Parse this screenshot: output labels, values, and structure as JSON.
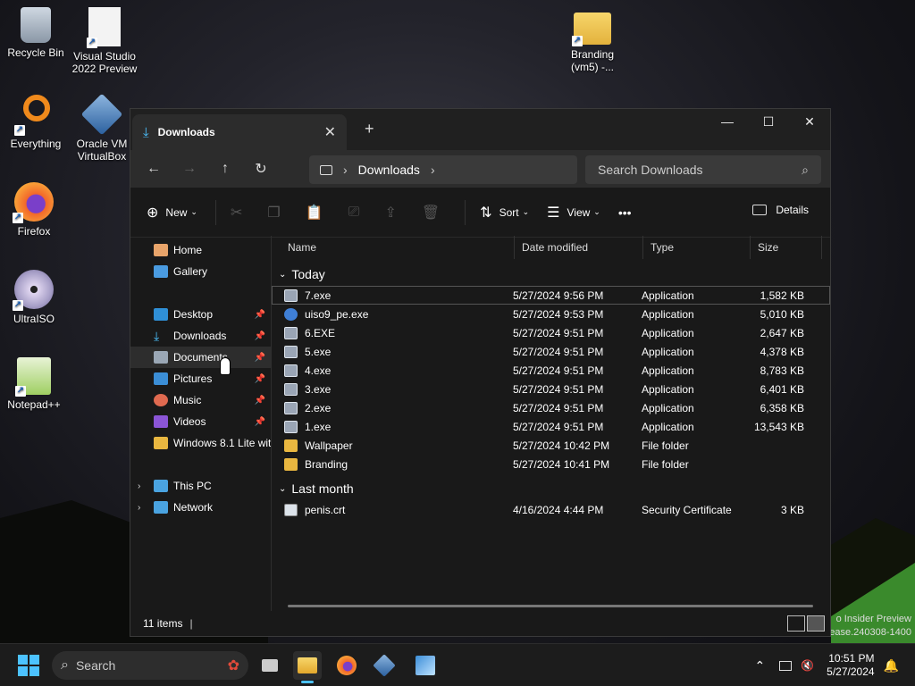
{
  "desktop": {
    "icons": [
      {
        "id": "recycle",
        "label": "Recycle Bin",
        "icon": "recycle-bin-icon"
      },
      {
        "id": "vs",
        "label": "Visual Studio 2022 Preview",
        "icon": "document-icon"
      },
      {
        "id": "branding",
        "label": "Branding (vm5) -...",
        "icon": "folder-icon"
      },
      {
        "id": "everything",
        "label": "Everything",
        "icon": "magnifier-icon"
      },
      {
        "id": "vbox",
        "label": "Oracle VM VirtualBox",
        "icon": "virtualbox-icon"
      },
      {
        "id": "firefox",
        "label": "Firefox",
        "icon": "firefox-icon"
      },
      {
        "id": "ultraiso",
        "label": "UltraISO",
        "icon": "disc-icon"
      },
      {
        "id": "notepadpp",
        "label": "Notepad++",
        "icon": "notepadpp-icon"
      }
    ],
    "watermark": [
      "o Insider Preview",
      "ease.240308-1400"
    ]
  },
  "explorer": {
    "tab_title": "Downloads",
    "window_controls": {
      "minimize": "—",
      "maximize": "☐",
      "close": "✕"
    },
    "address": {
      "location": "Downloads"
    },
    "search": {
      "placeholder": "Search Downloads"
    },
    "commands": {
      "new": "New",
      "sort": "Sort",
      "view": "View",
      "more": "•••",
      "details": "Details"
    },
    "nav": {
      "home": "Home",
      "gallery": "Gallery",
      "desktop": "Desktop",
      "downloads": "Downloads",
      "documents": "Documents",
      "pictures": "Pictures",
      "music": "Music",
      "videos": "Videos",
      "win81": "Windows 8.1 Lite wit",
      "thispc": "This PC",
      "network": "Network"
    },
    "columns": {
      "name": "Name",
      "date": "Date modified",
      "type": "Type",
      "size": "Size"
    },
    "groups": {
      "today": "Today",
      "last_month": "Last month"
    },
    "today": [
      {
        "name": "7.exe",
        "date": "5/27/2024 9:56 PM",
        "type": "Application",
        "size": "1,582 KB",
        "icon": "exe"
      },
      {
        "name": "uiso9_pe.exe",
        "date": "5/27/2024 9:53 PM",
        "type": "Application",
        "size": "5,010 KB",
        "icon": "globe"
      },
      {
        "name": "6.EXE",
        "date": "5/27/2024 9:51 PM",
        "type": "Application",
        "size": "2,647 KB",
        "icon": "exe"
      },
      {
        "name": "5.exe",
        "date": "5/27/2024 9:51 PM",
        "type": "Application",
        "size": "4,378 KB",
        "icon": "exe"
      },
      {
        "name": "4.exe",
        "date": "5/27/2024 9:51 PM",
        "type": "Application",
        "size": "8,783 KB",
        "icon": "exe"
      },
      {
        "name": "3.exe",
        "date": "5/27/2024 9:51 PM",
        "type": "Application",
        "size": "6,401 KB",
        "icon": "exe"
      },
      {
        "name": "2.exe",
        "date": "5/27/2024 9:51 PM",
        "type": "Application",
        "size": "6,358 KB",
        "icon": "exe"
      },
      {
        "name": "1.exe",
        "date": "5/27/2024 9:51 PM",
        "type": "Application",
        "size": "13,543 KB",
        "icon": "exe"
      },
      {
        "name": "Wallpaper",
        "date": "5/27/2024 10:42 PM",
        "type": "File folder",
        "size": "",
        "icon": "folder"
      },
      {
        "name": "Branding",
        "date": "5/27/2024 10:41 PM",
        "type": "File folder",
        "size": "",
        "icon": "folder"
      }
    ],
    "last_month": [
      {
        "name": "penis.crt",
        "date": "4/16/2024 4:44 PM",
        "type": "Security Certificate",
        "size": "3 KB",
        "icon": "cert"
      }
    ],
    "status": {
      "count": "11 items"
    }
  },
  "taskbar": {
    "search_label": "Search",
    "time": "10:51 PM",
    "date": "5/27/2024"
  }
}
